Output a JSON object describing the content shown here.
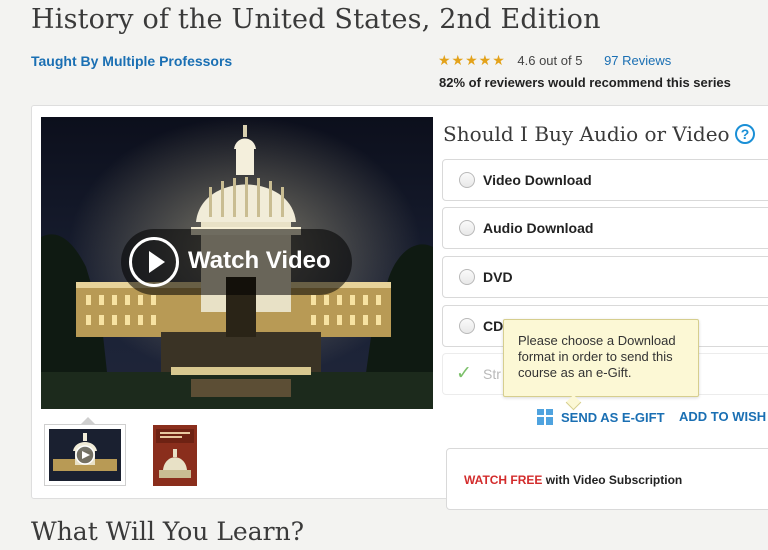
{
  "course": {
    "title": "History of the United States, 2nd Edition",
    "taught_by": "Taught By Multiple Professors",
    "stars": "★★★★★",
    "rating_text": "4.6 out of 5",
    "reviews_link": "97 Reviews",
    "recommend_text": "82% of reviewers would recommend this series"
  },
  "media": {
    "watch_video_label": "Watch Video",
    "thumbnails": [
      "video-thumbnail",
      "dvd-cover-thumbnail"
    ]
  },
  "purchase": {
    "heading": "Should I Buy Audio or Video",
    "help_glyph": "?",
    "options": [
      {
        "label": "Video Download"
      },
      {
        "label": "Audio Download"
      },
      {
        "label": "DVD"
      },
      {
        "label": "CD"
      },
      {
        "label": "Str"
      }
    ],
    "tooltip": "Please choose a Download format in order to send this course as an e-Gift.",
    "send_gift": "SEND AS E-GIFT",
    "add_wishlist": "ADD TO WISH",
    "watch_free_red": "WATCH FREE",
    "watch_free_rest": " with Video Subscription"
  },
  "section": {
    "what_will_you_learn": "What Will You Learn?"
  },
  "colors": {
    "link_blue": "#1a6fb3",
    "star_gold": "#e3a21a",
    "watch_free_red": "#d32c2c",
    "tooltip_bg": "#fcf8d5",
    "check_green": "#7cc06a"
  }
}
